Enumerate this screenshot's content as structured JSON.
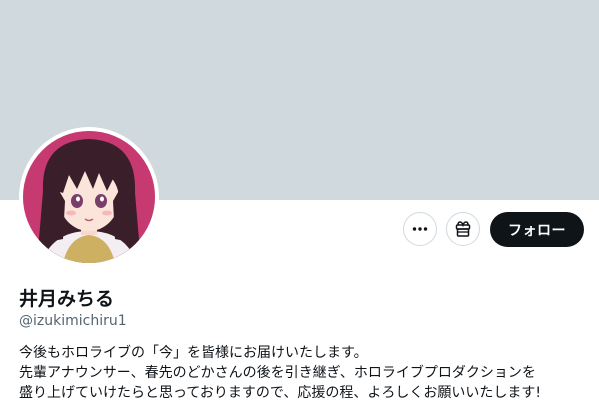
{
  "profile": {
    "display_name": "井月みちる",
    "handle": "@izukimichiru1",
    "bio_lines": [
      "今後もホロライブの「今」を皆様にお届けいたします。",
      "先輩アナウンサー、春先のどかさんの後を引き継ぎ、ホロライブプロダクションを",
      "盛り上げていけたらと思っておりますので、応援の程、よろしくお願いいたします!"
    ]
  },
  "actions": {
    "more_icon": "more-icon",
    "subscribe_icon": "subscribe-icon",
    "follow_label": "フォロー"
  },
  "colors": {
    "banner": "#cfd9de",
    "follow_bg": "#0f1419",
    "handle_text": "#536471",
    "avatar_bg": "#c2306a"
  }
}
